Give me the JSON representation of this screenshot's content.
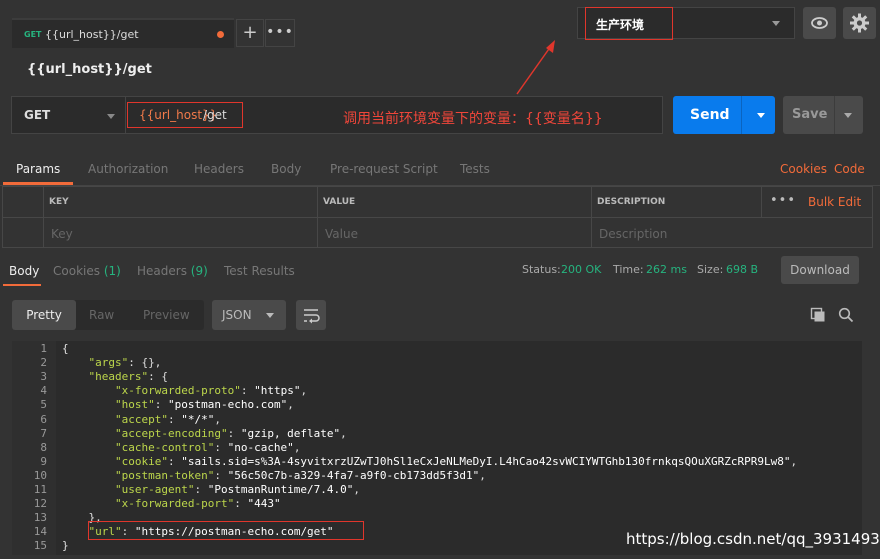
{
  "tab": {
    "method": "GET",
    "name": "{{url_host}}/get"
  },
  "environment": {
    "selected": "生产环境"
  },
  "request": {
    "title": "{{url_host}}/get",
    "method": "GET",
    "url_variable": "{{url_host}}",
    "url_path": "/get",
    "annotation": "调用当前环境变量下的变量：{{变量名}}"
  },
  "buttons": {
    "send": "Send",
    "save": "Save",
    "download": "Download",
    "bulk_edit": "Bulk Edit"
  },
  "request_tabs": [
    "Params",
    "Authorization",
    "Headers",
    "Body",
    "Pre-request Script",
    "Tests"
  ],
  "request_links": [
    "Cookies",
    "Code"
  ],
  "params_table": {
    "headers": [
      "KEY",
      "VALUE",
      "DESCRIPTION"
    ],
    "placeholders": [
      "Key",
      "Value",
      "Description"
    ]
  },
  "response_tabs": [
    {
      "label": "Body",
      "count": ""
    },
    {
      "label": "Cookies",
      "count": "(1)"
    },
    {
      "label": "Headers",
      "count": "(9)"
    },
    {
      "label": "Test Results",
      "count": ""
    }
  ],
  "status": {
    "status_label": "Status:",
    "status_value": "200 OK",
    "time_label": "Time:",
    "time_value": "262 ms",
    "size_label": "Size:",
    "size_value": "698 B"
  },
  "view_modes": [
    "Pretty",
    "Raw",
    "Preview"
  ],
  "format": "JSON",
  "code_lines": [
    "{",
    "    \"args\": {},",
    "    \"headers\": {",
    "        \"x-forwarded-proto\": \"https\",",
    "        \"host\": \"postman-echo.com\",",
    "        \"accept\": \"*/*\",",
    "        \"accept-encoding\": \"gzip, deflate\",",
    "        \"cache-control\": \"no-cache\",",
    "        \"cookie\": \"sails.sid=s%3A-4syvitxrzUZwTJ0hSl1eCxJeNLMeDyI.L4hCao42svWCIYWTGhb130frnkqsQOuXGRZcRPR9Lw8\",",
    "        \"postman-token\": \"56c50c7b-a329-4fa7-a9f0-cb173dd5f3d1\",",
    "        \"user-agent\": \"PostmanRuntime/7.4.0\",",
    "        \"x-forwarded-port\": \"443\"",
    "    },",
    "    \"url\": \"https://postman-echo.com/get\"",
    "}"
  ],
  "watermark": "https://blog.csdn.net/qq_39314932",
  "colors": {
    "accent": "#f26b3a",
    "send": "#097bed",
    "ok": "#26b47f",
    "annotation": "#e0362c",
    "json_key": "#bcd64b"
  },
  "icons": [
    "plus-icon",
    "more-icon",
    "eye-icon",
    "gear-icon",
    "wrap-icon",
    "copy-icon",
    "search-icon",
    "chevron-down-icon"
  ]
}
